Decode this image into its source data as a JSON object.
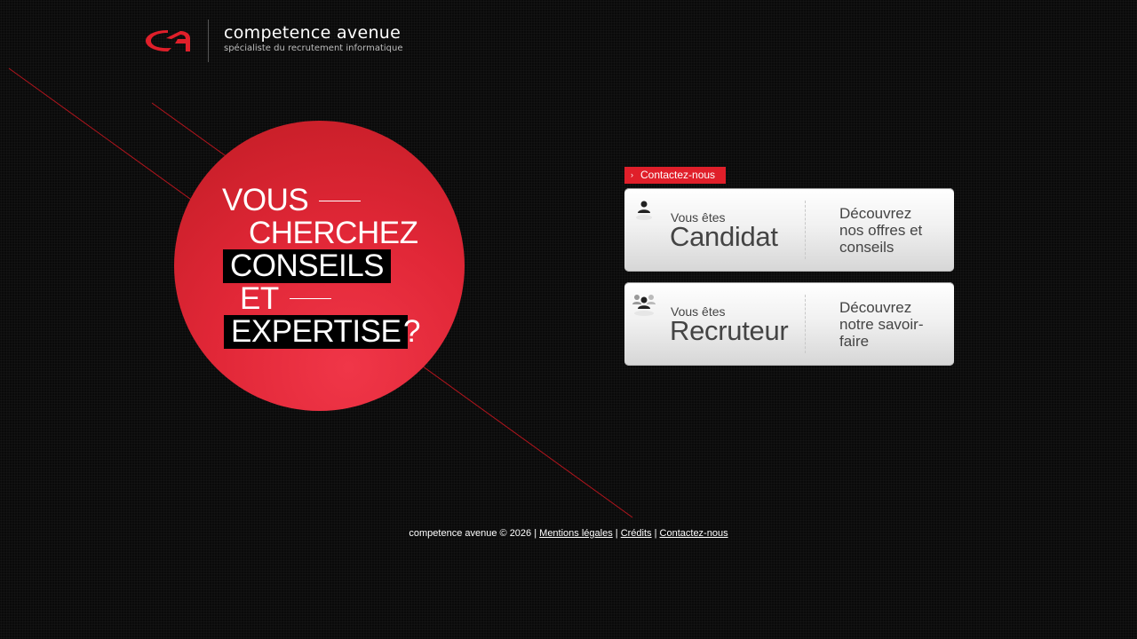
{
  "brand": {
    "name": "competence avenue",
    "tagline": "spécialiste du recrutement informatique",
    "accent_color": "#e01f2a"
  },
  "headline": {
    "line1": "VOUS",
    "line2": "CHERCHEZ",
    "line3": "CONSEILS",
    "line4": "ET",
    "line5": "EXPERTISE",
    "question": "?"
  },
  "contact_tab": {
    "label": "Contactez-nous",
    "icon": "chevron-right-icon"
  },
  "cards": [
    {
      "prefix": "Vous êtes",
      "title": "Candidat",
      "description": "Découvrez nos offres et conseils",
      "icon": "person-icon"
    },
    {
      "prefix": "Vous êtes",
      "title": "Recruteur",
      "description": "Découvrez notre savoir-faire",
      "icon": "group-icon"
    }
  ],
  "footer": {
    "copyright": "competence avenue © 2026",
    "separator": "|",
    "links": [
      "Mentions légales",
      "Crédits",
      "Contactez-nous"
    ]
  }
}
